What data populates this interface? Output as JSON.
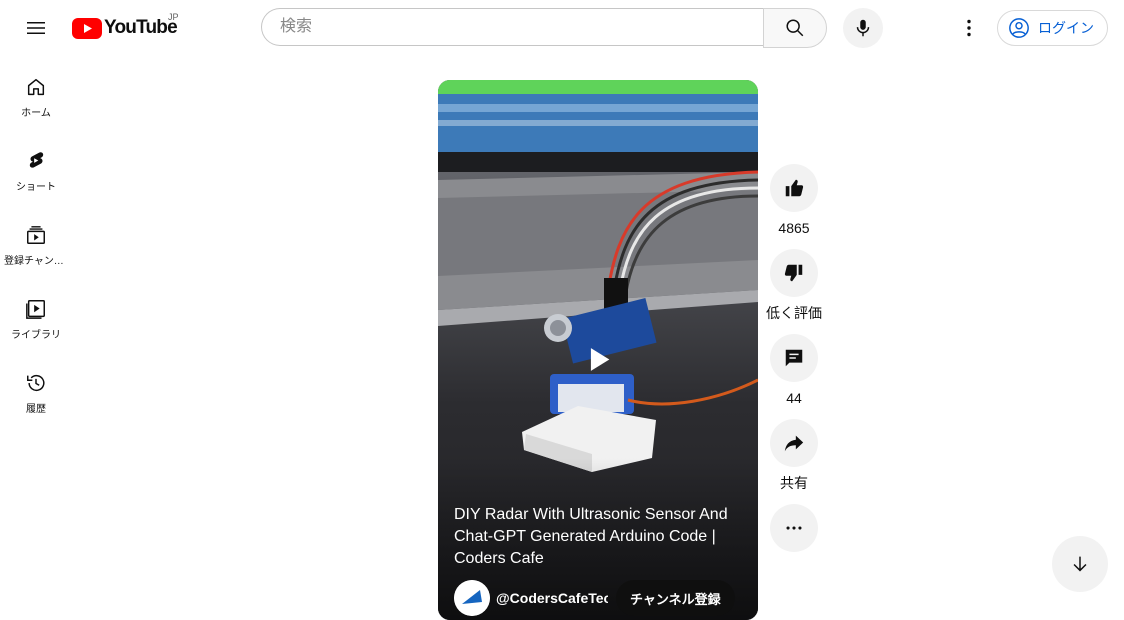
{
  "header": {
    "logo_text": "YouTube",
    "region_code": "JP",
    "search_placeholder": "検索",
    "login_label": "ログイン"
  },
  "sidebar": {
    "items": [
      {
        "label": "ホーム",
        "icon": "home-icon"
      },
      {
        "label": "ショート",
        "icon": "shorts-icon"
      },
      {
        "label": "登録チャンネル",
        "icon": "subscriptions-icon"
      },
      {
        "label": "ライブラリ",
        "icon": "library-icon"
      },
      {
        "label": "履歴",
        "icon": "history-icon"
      }
    ]
  },
  "short": {
    "title": "DIY Radar With Ultrasonic Sensor And Chat-GPT Generated Arduino Code | Coders Cafe",
    "channel_name": "@CodersCafeTec",
    "subscribe_label": "チャンネル登録"
  },
  "actions": {
    "like_count": "4865",
    "dislike_label": "低く評価",
    "comment_count": "44",
    "share_label": "共有"
  },
  "colors": {
    "brand_red": "#ff0000",
    "link_blue": "#065fd4",
    "button_bg": "#f2f2f2"
  }
}
